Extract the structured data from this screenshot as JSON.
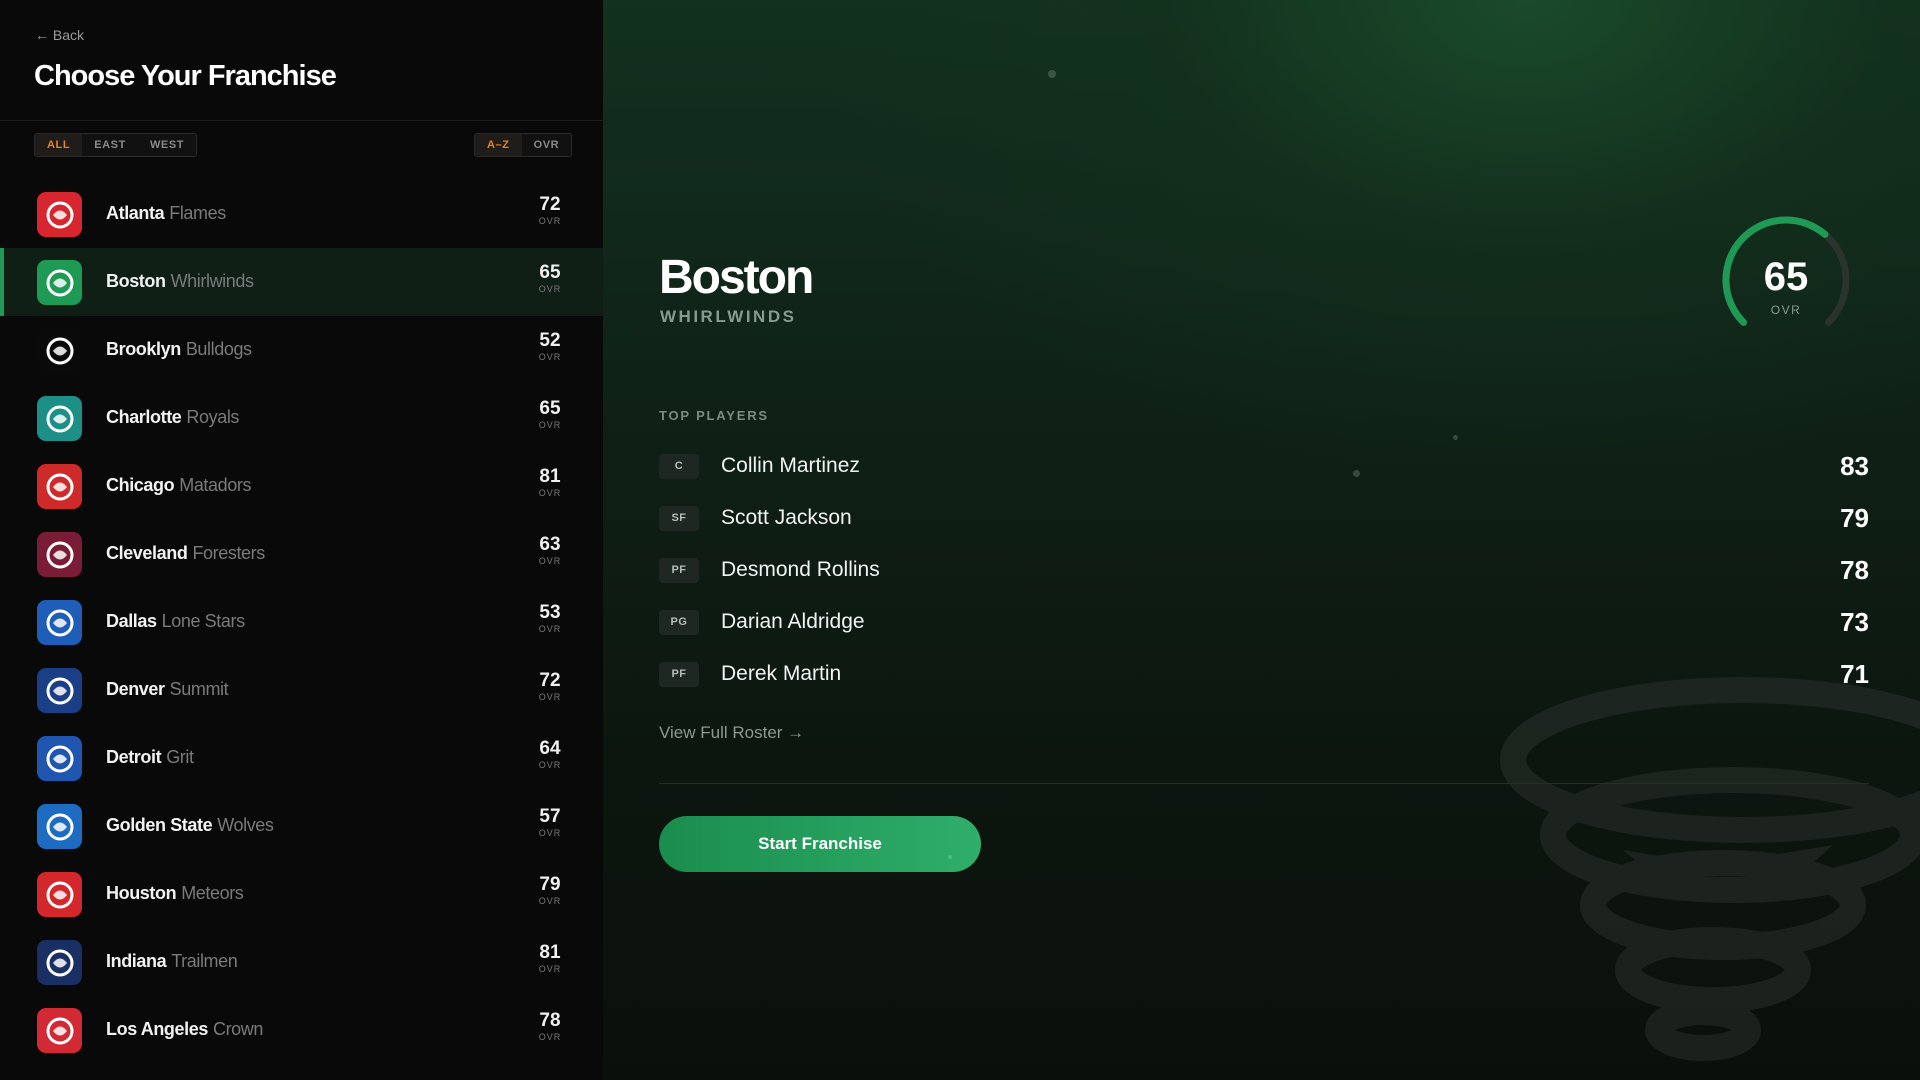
{
  "back_label": "← Back",
  "page_title": "Choose Your Franchise",
  "region_filter": [
    "ALL",
    "EAST",
    "WEST"
  ],
  "sort_filter": [
    "A–Z",
    "OVR"
  ],
  "ovr_label": "OVR",
  "teams": [
    {
      "city": "Atlanta",
      "mascot": "Flames",
      "ovr": "72",
      "color": "#d8262e",
      "icon": "flames-logo-icon"
    },
    {
      "city": "Boston",
      "mascot": "Whirlwinds",
      "ovr": "65",
      "color": "#1e9a55",
      "icon": "whirlwind-logo-icon"
    },
    {
      "city": "Brooklyn",
      "mascot": "Bulldogs",
      "ovr": "52",
      "color": "#0a0a0a",
      "icon": "bulldog-logo-icon"
    },
    {
      "city": "Charlotte",
      "mascot": "Royals",
      "ovr": "65",
      "color": "#1c8f86",
      "icon": "royal-logo-icon"
    },
    {
      "city": "Chicago",
      "mascot": "Matadors",
      "ovr": "81",
      "color": "#cf2a2a",
      "icon": "bull-logo-icon"
    },
    {
      "city": "Cleveland",
      "mascot": "Foresters",
      "ovr": "63",
      "color": "#7a1c35",
      "icon": "forester-logo-icon"
    },
    {
      "city": "Dallas",
      "mascot": "Lone Stars",
      "ovr": "53",
      "color": "#1f5eb8",
      "icon": "cowboy-logo-icon"
    },
    {
      "city": "Denver",
      "mascot": "Summit",
      "ovr": "72",
      "color": "#1a3f86",
      "icon": "bear-logo-icon"
    },
    {
      "city": "Detroit",
      "mascot": "Grit",
      "ovr": "64",
      "color": "#1e56b0",
      "icon": "grit-logo-icon"
    },
    {
      "city": "Golden State",
      "mascot": "Wolves",
      "ovr": "57",
      "color": "#1d6cc2",
      "icon": "wolf-logo-icon"
    },
    {
      "city": "Houston",
      "mascot": "Meteors",
      "ovr": "79",
      "color": "#d3272b",
      "icon": "meteor-logo-icon"
    },
    {
      "city": "Indiana",
      "mascot": "Trailmen",
      "ovr": "81",
      "color": "#1a2f63",
      "icon": "trailman-logo-icon"
    },
    {
      "city": "Los Angeles",
      "mascot": "Crown",
      "ovr": "78",
      "color": "#d22a35",
      "icon": "crown-logo-icon"
    }
  ],
  "selected": {
    "city": "Boston",
    "mascot": "WHIRLWINDS",
    "ovr": "65",
    "ovr_fraction": 0.65,
    "top_players_label": "TOP PLAYERS",
    "players": [
      {
        "pos": "C",
        "name": "Collin Martinez",
        "ovr": "83"
      },
      {
        "pos": "SF",
        "name": "Scott Jackson",
        "ovr": "79"
      },
      {
        "pos": "PF",
        "name": "Desmond Rollins",
        "ovr": "78"
      },
      {
        "pos": "PG",
        "name": "Darian Aldridge",
        "ovr": "73"
      },
      {
        "pos": "PF",
        "name": "Derek Martin",
        "ovr": "71"
      }
    ],
    "roster_link": "View Full Roster →",
    "start_label": "Start Franchise"
  },
  "colors": {
    "accent_orange": "#e8822a",
    "accent_green": "#1f9a55"
  }
}
